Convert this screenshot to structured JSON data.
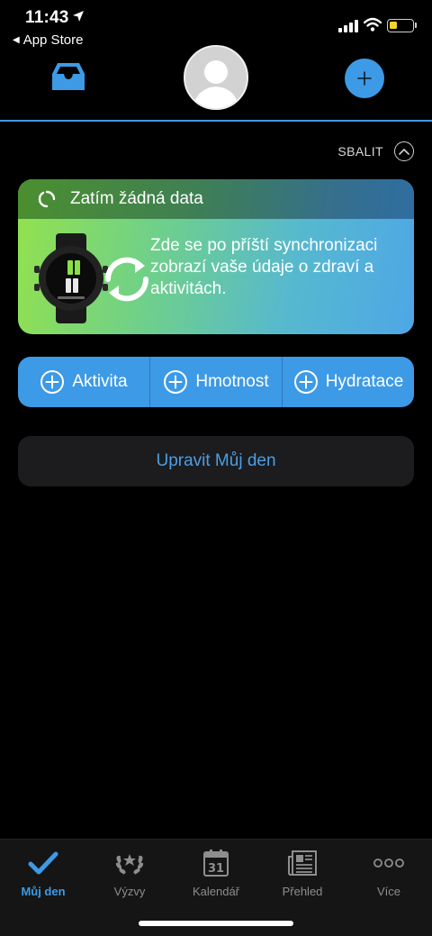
{
  "status_bar": {
    "time": "11:43",
    "back_app": "App Store",
    "icons": [
      "location-arrow-icon",
      "signal-bars-icon",
      "wifi-icon",
      "battery-icon"
    ]
  },
  "header": {
    "inbox_icon": "inbox-icon",
    "avatar_icon": "user-avatar",
    "add_label": "+",
    "accent_color": "#3d9ae6"
  },
  "collapse": {
    "label": "SBALIT",
    "icon": "chevron-up-icon"
  },
  "sync_card": {
    "title": "Zatím žádná data",
    "message": "Zde se po příští synchronizaci zobrazí vaše údaje o zdraví a aktivitách.",
    "icons": [
      "sync-spinner-icon",
      "watch-illustration",
      "sync-arrows-icon"
    ]
  },
  "quick_add": {
    "buttons": [
      {
        "label": "Aktivita",
        "icon": "plus-circle-icon"
      },
      {
        "label": "Hmotnost",
        "icon": "plus-circle-icon"
      },
      {
        "label": "Hydratace",
        "icon": "plus-circle-icon"
      }
    ]
  },
  "edit_day": {
    "label": "Upravit Můj den"
  },
  "tab_bar": {
    "tabs": [
      {
        "label": "Můj den",
        "icon": "checkmark-icon",
        "active": true
      },
      {
        "label": "Výzvy",
        "icon": "laurel-icon",
        "active": false
      },
      {
        "label": "Kalendář",
        "icon": "calendar-icon",
        "calendar_day": "31",
        "active": false
      },
      {
        "label": "Přehled",
        "icon": "newspaper-icon",
        "active": false
      },
      {
        "label": "Více",
        "icon": "more-dots-icon",
        "active": false
      }
    ]
  }
}
